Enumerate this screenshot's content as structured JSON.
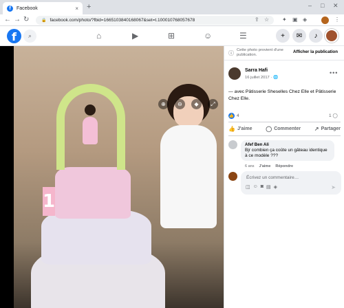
{
  "browser": {
    "tab_title": "Facebook",
    "tab_close": "×",
    "new_tab": "+",
    "url": "facebook.com/photo/?fbid=1665103840168067&set=t.100010768057678",
    "controls": {
      "minimize": "–",
      "maximize": "□",
      "close": "✕"
    }
  },
  "fb_header": {
    "logo": "f",
    "icons": [
      "search-icon",
      "home-icon",
      "watch-icon",
      "marketplace-icon",
      "groups-icon",
      "menu-icon",
      "create-icon",
      "messenger-icon",
      "notifications-icon",
      "profile-icon"
    ]
  },
  "notice": {
    "text": "Cette photo provient d'une publication.",
    "button": "Afficher la publication"
  },
  "post": {
    "author": "Sarra Hafi",
    "date": "16 juillet 2017 ·",
    "more": "•••",
    "caption": "— avec Pâtisserie Sheselles Chez Elle et Pâtisserie Chez Elle.",
    "like_count": "4",
    "comment_count": "1"
  },
  "photo": {
    "digit": "1"
  },
  "actions": {
    "like": "J'aime",
    "comment": "Commenter",
    "share": "Partager"
  },
  "comment": {
    "author": "Afef Ben Ali",
    "text": "Bjr combien ça coûte un gâteau identique à ce modèle ???",
    "time": "6 ans",
    "like": "J'aime",
    "reply": "Répondre"
  },
  "writer": {
    "placeholder": "Écrivez un commentaire…",
    "send": "➤"
  },
  "colors": {
    "brand": "#1877f2",
    "panel_bg": "#ffffff",
    "bubble_bg": "#f0f2f5",
    "secondary_text": "#65676b"
  }
}
